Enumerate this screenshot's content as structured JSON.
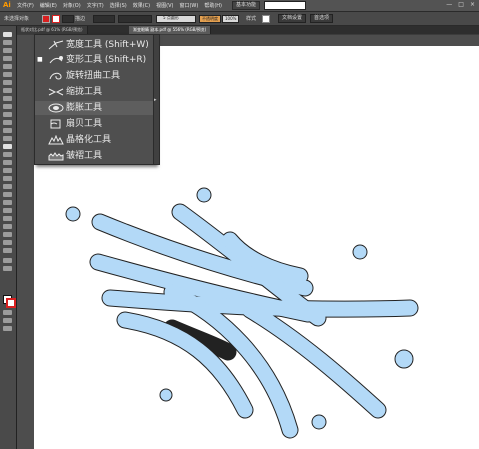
{
  "menubar": {
    "logo": "Ai",
    "menus": [
      "文件(F)",
      "编辑(E)",
      "对象(O)",
      "文字(T)",
      "选择(S)",
      "效果(C)",
      "视图(V)",
      "窗口(W)",
      "帮助(H)"
    ],
    "workspace_label": "基本功能",
    "window_controls": [
      "—",
      "□",
      "×"
    ]
  },
  "control": {
    "selection_label": "未选择对象",
    "stroke_label": "描边",
    "brush_label": "5 点圆形",
    "opacity_label": "不透明度",
    "opacity_value": "100%",
    "style_label": "样式",
    "doc_setup": "文档设置",
    "prefs": "首选项",
    "fill_color": "#d92020"
  },
  "tabs": [
    {
      "label": "瓶状对比.pdf @ 61% (RGB/预览)"
    },
    {
      "label": "渐变眼睛 副本.pdf @ 556% (RGB/预览)"
    }
  ],
  "flyout": {
    "items": [
      {
        "label": "宽度工具 (Shift+W)",
        "icon": "width-tool-icon",
        "bullet": ""
      },
      {
        "label": "变形工具 (Shift+R)",
        "icon": "warp-tool-icon",
        "bullet": "■"
      },
      {
        "label": "旋转扭曲工具",
        "icon": "twirl-tool-icon",
        "bullet": ""
      },
      {
        "label": "缩拢工具",
        "icon": "pucker-tool-icon",
        "bullet": ""
      },
      {
        "label": "膨胀工具",
        "icon": "bloat-tool-icon",
        "bullet": ""
      },
      {
        "label": "扇贝工具",
        "icon": "scallop-tool-icon",
        "bullet": ""
      },
      {
        "label": "晶格化工具",
        "icon": "crystallize-tool-icon",
        "bullet": ""
      },
      {
        "label": "皱褶工具",
        "icon": "wrinkle-tool-icon",
        "bullet": ""
      }
    ],
    "hover_index": 4
  },
  "artwork": {
    "fill_color": "#b3d9f7",
    "stroke_color": "#222222"
  }
}
